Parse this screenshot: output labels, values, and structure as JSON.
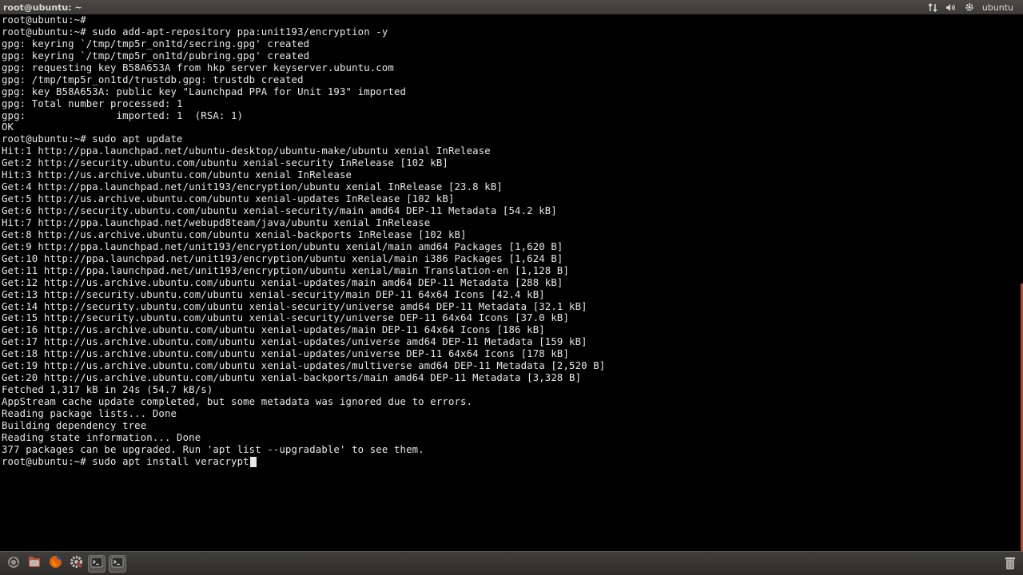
{
  "window": {
    "title": "root@ubuntu: ~"
  },
  "panel": {
    "user": "ubuntu",
    "icons": [
      "network-icon",
      "volume-icon",
      "gear-icon"
    ]
  },
  "terminal": {
    "lines": [
      "root@ubuntu:~#",
      "root@ubuntu:~# sudo add-apt-repository ppa:unit193/encryption -y",
      "gpg: keyring `/tmp/tmp5r_on1td/secring.gpg' created",
      "gpg: keyring `/tmp/tmp5r_on1td/pubring.gpg' created",
      "gpg: requesting key B58A653A from hkp server keyserver.ubuntu.com",
      "gpg: /tmp/tmp5r_on1td/trustdb.gpg: trustdb created",
      "gpg: key B58A653A: public key \"Launchpad PPA for Unit 193\" imported",
      "gpg: Total number processed: 1",
      "gpg:               imported: 1  (RSA: 1)",
      "OK",
      "root@ubuntu:~# sudo apt update",
      "Hit:1 http://ppa.launchpad.net/ubuntu-desktop/ubuntu-make/ubuntu xenial InRelease",
      "Get:2 http://security.ubuntu.com/ubuntu xenial-security InRelease [102 kB]",
      "Hit:3 http://us.archive.ubuntu.com/ubuntu xenial InRelease",
      "Get:4 http://ppa.launchpad.net/unit193/encryption/ubuntu xenial InRelease [23.8 kB]",
      "Get:5 http://us.archive.ubuntu.com/ubuntu xenial-updates InRelease [102 kB]",
      "Get:6 http://security.ubuntu.com/ubuntu xenial-security/main amd64 DEP-11 Metadata [54.2 kB]",
      "Hit:7 http://ppa.launchpad.net/webupd8team/java/ubuntu xenial InRelease",
      "Get:8 http://us.archive.ubuntu.com/ubuntu xenial-backports InRelease [102 kB]",
      "Get:9 http://ppa.launchpad.net/unit193/encryption/ubuntu xenial/main amd64 Packages [1,620 B]",
      "Get:10 http://ppa.launchpad.net/unit193/encryption/ubuntu xenial/main i386 Packages [1,624 B]",
      "Get:11 http://ppa.launchpad.net/unit193/encryption/ubuntu xenial/main Translation-en [1,128 B]",
      "Get:12 http://us.archive.ubuntu.com/ubuntu xenial-updates/main amd64 DEP-11 Metadata [288 kB]",
      "Get:13 http://security.ubuntu.com/ubuntu xenial-security/main DEP-11 64x64 Icons [42.4 kB]",
      "Get:14 http://security.ubuntu.com/ubuntu xenial-security/universe amd64 DEP-11 Metadata [32.1 kB]",
      "Get:15 http://security.ubuntu.com/ubuntu xenial-security/universe DEP-11 64x64 Icons [37.0 kB]",
      "Get:16 http://us.archive.ubuntu.com/ubuntu xenial-updates/main DEP-11 64x64 Icons [186 kB]",
      "Get:17 http://us.archive.ubuntu.com/ubuntu xenial-updates/universe amd64 DEP-11 Metadata [159 kB]",
      "Get:18 http://us.archive.ubuntu.com/ubuntu xenial-updates/universe DEP-11 64x64 Icons [178 kB]",
      "Get:19 http://us.archive.ubuntu.com/ubuntu xenial-updates/multiverse amd64 DEP-11 Metadata [2,520 B]",
      "Get:20 http://us.archive.ubuntu.com/ubuntu xenial-backports/main amd64 DEP-11 Metadata [3,328 B]",
      "Fetched 1,317 kB in 24s (54.7 kB/s)",
      "AppStream cache update completed, but some metadata was ignored due to errors.",
      "Reading package lists... Done",
      "Building dependency tree",
      "Reading state information... Done",
      "377 packages can be upgraded. Run 'apt list --upgradable' to see them."
    ],
    "current_prompt": "root@ubuntu:~# sudo apt install veracrypt"
  },
  "launcher": {
    "items": [
      {
        "name": "dash-home-icon",
        "active": false
      },
      {
        "name": "files-icon",
        "active": false
      },
      {
        "name": "firefox-icon",
        "active": false
      },
      {
        "name": "system-settings-icon",
        "active": false
      },
      {
        "name": "terminal-icon",
        "active": true
      },
      {
        "name": "terminal-icon",
        "active": true
      }
    ],
    "trash": "trash-icon"
  },
  "colors": {
    "terminal_bg": "#000000",
    "terminal_fg": "#e8e8e8",
    "panel_bg": "#3c3b37",
    "scrollbar": "#a84d38",
    "firefox": "#e66000"
  }
}
